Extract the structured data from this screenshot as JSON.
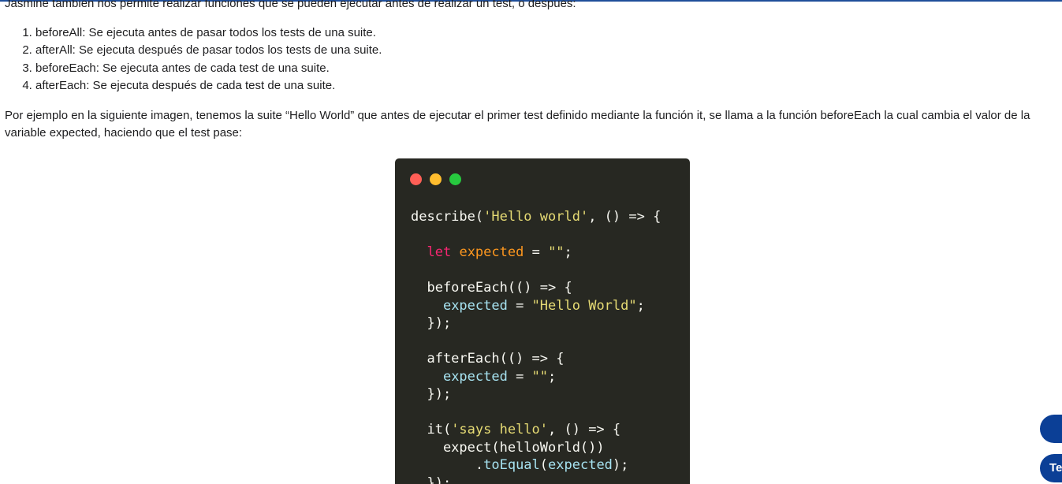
{
  "article": {
    "intro": "Jasmine también nos permite realizar funciones que se pueden ejecutar antes de realizar un test, o después:",
    "steps": [
      "beforeAll: Se ejecuta antes de pasar todos los tests de una suite.",
      "afterAll: Se ejecuta después de pasar todos los tests de una suite.",
      "beforeEach: Se ejecuta antes de cada test de una suite.",
      "afterEach: Se ejecuta después de cada test de una suite."
    ],
    "example": "Por ejemplo en la siguiente imagen, tenemos la suite “Hello World” que antes de ejecutar el primer test definido mediante la función it, se llama a la función beforeEach la cual cambia el valor de la variable expected, haciendo que el test pase:"
  },
  "code_window": {
    "controls": [
      "close",
      "minimize",
      "maximize"
    ],
    "theme": {
      "background": "#272822",
      "plain": "#f8f8f2",
      "string": "#e6db74",
      "keyword": "#f92672",
      "variable": "#fd971f",
      "property": "#a6e2f0"
    },
    "lines": [
      [
        {
          "t": "describe(",
          "c": "plain"
        },
        {
          "t": "'Hello world'",
          "c": "string"
        },
        {
          "t": ", () => {",
          "c": "plain"
        }
      ],
      [],
      [
        {
          "t": "  ",
          "c": "plain"
        },
        {
          "t": "let",
          "c": "keyword"
        },
        {
          "t": " ",
          "c": "plain"
        },
        {
          "t": "expected",
          "c": "variable"
        },
        {
          "t": " = ",
          "c": "plain"
        },
        {
          "t": "\"\"",
          "c": "string"
        },
        {
          "t": ";",
          "c": "plain"
        }
      ],
      [],
      [
        {
          "t": "  beforeEach(() => {",
          "c": "plain"
        }
      ],
      [
        {
          "t": "    ",
          "c": "plain"
        },
        {
          "t": "expected",
          "c": "prop"
        },
        {
          "t": " = ",
          "c": "plain"
        },
        {
          "t": "\"Hello World\"",
          "c": "string"
        },
        {
          "t": ";",
          "c": "plain"
        }
      ],
      [
        {
          "t": "  });",
          "c": "plain"
        }
      ],
      [],
      [
        {
          "t": "  afterEach(() => {",
          "c": "plain"
        }
      ],
      [
        {
          "t": "    ",
          "c": "plain"
        },
        {
          "t": "expected",
          "c": "prop"
        },
        {
          "t": " = ",
          "c": "plain"
        },
        {
          "t": "\"\"",
          "c": "string"
        },
        {
          "t": ";",
          "c": "plain"
        }
      ],
      [
        {
          "t": "  });",
          "c": "plain"
        }
      ],
      [],
      [
        {
          "t": "  it(",
          "c": "plain"
        },
        {
          "t": "'says hello'",
          "c": "string"
        },
        {
          "t": ", () => {",
          "c": "plain"
        }
      ],
      [
        {
          "t": "    expect(helloWorld())",
          "c": "plain"
        }
      ],
      [
        {
          "t": "        .",
          "c": "plain"
        },
        {
          "t": "toEqual",
          "c": "prop"
        },
        {
          "t": "(",
          "c": "plain"
        },
        {
          "t": "expected",
          "c": "prop"
        },
        {
          "t": ");",
          "c": "plain"
        }
      ],
      [
        {
          "t": "  });",
          "c": "plain"
        }
      ]
    ]
  },
  "floating_buttons": [
    {
      "label": ""
    },
    {
      "label": "Te"
    }
  ],
  "colors": {
    "accent": "#0b3f96",
    "top_bar": "#1f4e9a"
  }
}
